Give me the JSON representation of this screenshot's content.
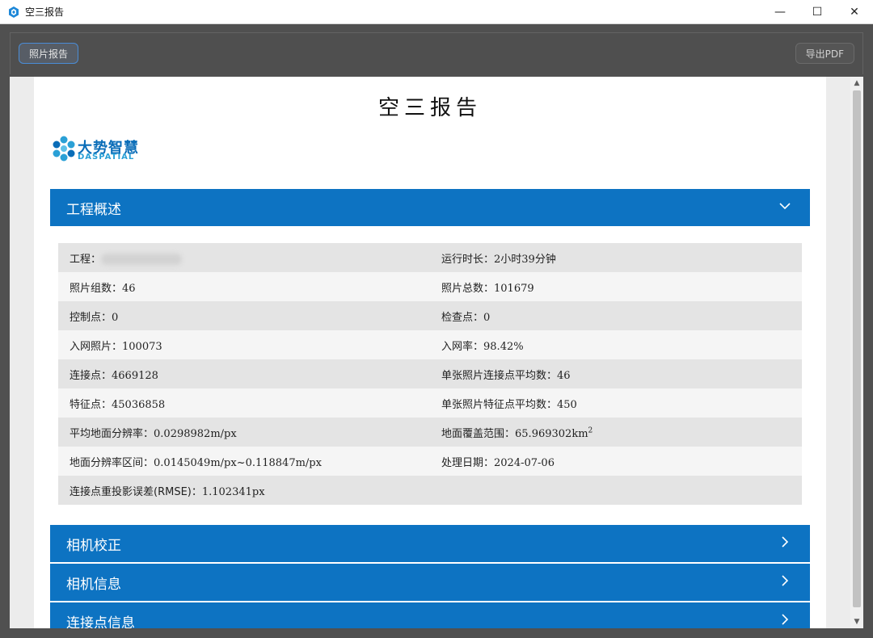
{
  "window": {
    "title": "空三报告",
    "minimize": "—",
    "maximize": "☐",
    "close": "✕"
  },
  "toolbar": {
    "photo_report_label": "照片报告",
    "export_pdf_label": "导出PDF"
  },
  "document": {
    "title": "空三报告",
    "logo_cn": "大势智慧",
    "logo_en": "DASPATIAL"
  },
  "sections": {
    "overview": "工程概述",
    "camera_calibration": "相机校正",
    "camera_info": "相机信息",
    "tiepoint_info": "连接点信息"
  },
  "overview": {
    "project_label": "工程：",
    "runtime_label": "运行时长：",
    "runtime_value": "2小时39分钟",
    "photo_groups_label": "照片组数：",
    "photo_groups_value": "46",
    "photo_total_label": "照片总数：",
    "photo_total_value": "101679",
    "control_points_label": "控制点：",
    "control_points_value": "0",
    "check_points_label": "检查点：",
    "check_points_value": "0",
    "network_photos_label": "入网照片：",
    "network_photos_value": "100073",
    "network_rate_label": "入网率：",
    "network_rate_value": "98.42%",
    "tie_points_label": "连接点：",
    "tie_points_value": "4669128",
    "avg_tie_label": "单张照片连接点平均数：",
    "avg_tie_value": "46",
    "feature_points_label": "特征点：",
    "feature_points_value": "45036858",
    "avg_feature_label": "单张照片特征点平均数：",
    "avg_feature_value": "450",
    "avg_gsd_label": "平均地面分辨率：",
    "avg_gsd_value": "0.0298982m/px",
    "coverage_label": "地面覆盖范围：",
    "coverage_value": "65.969302km",
    "coverage_sup": "2",
    "gsd_range_label": "地面分辨率区间：",
    "gsd_range_value": "0.0145049m/px~0.118847m/px",
    "date_label": "处理日期：",
    "date_value": "2024-07-06",
    "rmse_label": "连接点重投影误差(RMSE)：",
    "rmse_value": "1.102341px"
  },
  "colors": {
    "section_blue": "#0d73c2",
    "logo_blue": "#0a6db8",
    "logo_cyan": "#2aa0d6"
  }
}
